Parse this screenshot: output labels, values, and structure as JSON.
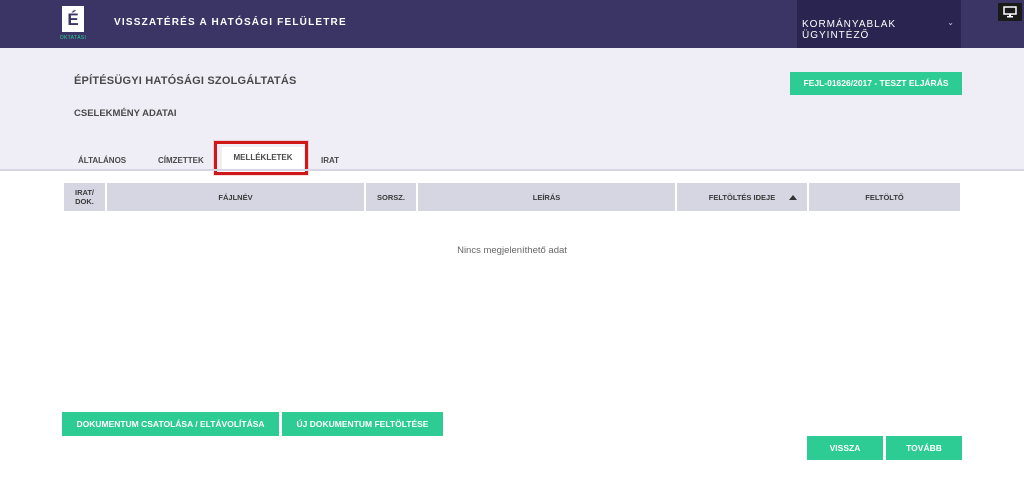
{
  "topbar": {
    "logo_letter": "É",
    "logo_sub": "OKTATÁSI",
    "back_link": "VISSZATÉRÉS A HATÓSÁGI FELÜLETRE",
    "user_menu": "KORMÁNYABLAK ÜGYINTÉZŐ",
    "chevron_icon": "chevron-down-icon",
    "monitor_icon": "monitor-icon"
  },
  "header": {
    "service_title": "ÉPÍTÉSÜGYI HATÓSÁGI SZOLGÁLTATÁS",
    "case_badge": "FEJL-01626/2017 - TESZT ELJÁRÁS",
    "section_title": "CSELEKMÉNY ADATAI"
  },
  "tabs": [
    {
      "label": "ÁLTALÁNOS"
    },
    {
      "label": "CÍMZETTEK"
    },
    {
      "label": "MELLÉKLETEK",
      "active": true
    },
    {
      "label": "IRAT"
    }
  ],
  "table": {
    "columns": [
      {
        "label_line1": "IRAT/",
        "label_line2": "DOK."
      },
      {
        "label": "FÁJLNÉV"
      },
      {
        "label": "SORSZ."
      },
      {
        "label": "LEÍRÁS"
      },
      {
        "label": "FELTÖLTÉS IDEJE",
        "sort": "asc"
      },
      {
        "label": "FELTÖLTŐ"
      }
    ],
    "empty_message": "Nincs megjeleníthető adat"
  },
  "actions": {
    "attach": "DOKUMENTUM CSATOLÁSA / ELTÁVOLÍTÁSA",
    "upload": "ÚJ DOKUMENTUM FELTÖLTÉSE",
    "back": "VISSZA",
    "next": "TOVÁBB"
  },
  "colors": {
    "topbar": "#3b3566",
    "accent": "#2ecc95",
    "highlight": "#d01818"
  }
}
